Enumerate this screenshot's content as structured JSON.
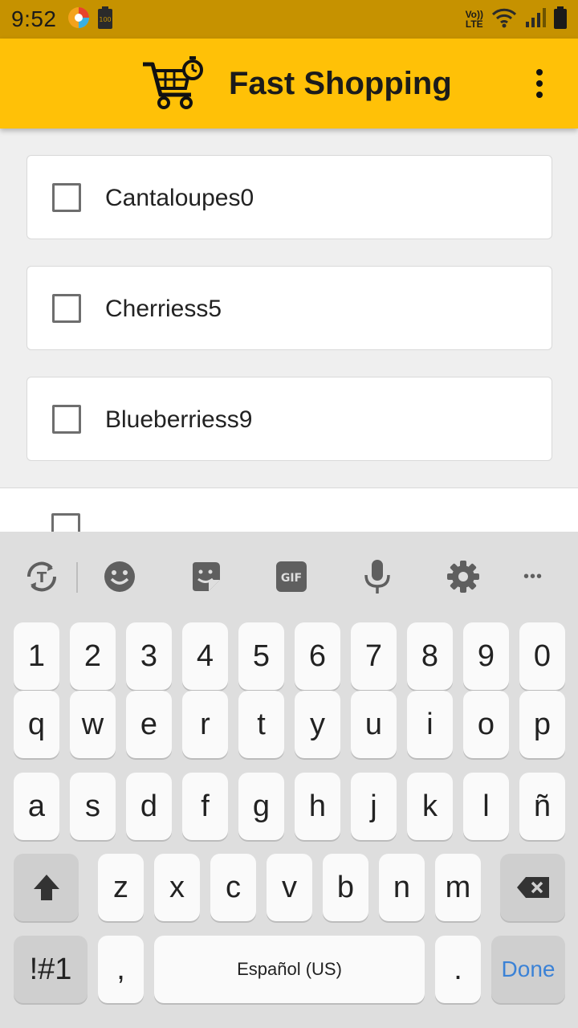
{
  "status_bar": {
    "time": "9:52",
    "battery_label": "100",
    "volte_top": "Vo))",
    "volte_bottom": "LTE"
  },
  "app_bar": {
    "title": "Fast Shopping"
  },
  "items": [
    {
      "label": "Cantaloupes0",
      "checked": false
    },
    {
      "label": "Cherriess5",
      "checked": false
    },
    {
      "label": "Blueberriess9",
      "checked": false
    },
    {
      "label": "",
      "checked": false
    }
  ],
  "keyboard": {
    "toolbar_icons": [
      "translate-icon",
      "emoji-icon",
      "sticker-icon",
      "gif-icon",
      "microphone-icon",
      "settings-icon",
      "more-icon"
    ],
    "gif_label": "GIF",
    "more_label": "•••",
    "row_numbers": [
      "1",
      "2",
      "3",
      "4",
      "5",
      "6",
      "7",
      "8",
      "9",
      "0"
    ],
    "row_top": [
      "q",
      "w",
      "e",
      "r",
      "t",
      "y",
      "u",
      "i",
      "o",
      "p"
    ],
    "row_middle": [
      "a",
      "s",
      "d",
      "f",
      "g",
      "h",
      "j",
      "k",
      "l",
      "ñ"
    ],
    "row_bottom": [
      "z",
      "x",
      "c",
      "v",
      "b",
      "n",
      "m"
    ],
    "symbols_label": "!#1",
    "comma_label": ",",
    "space_label": "Español (US)",
    "period_label": ".",
    "done_label": "Done"
  },
  "colors": {
    "status_bar": "#c69200",
    "app_bar": "#ffc107",
    "done_text": "#3b82d6"
  }
}
